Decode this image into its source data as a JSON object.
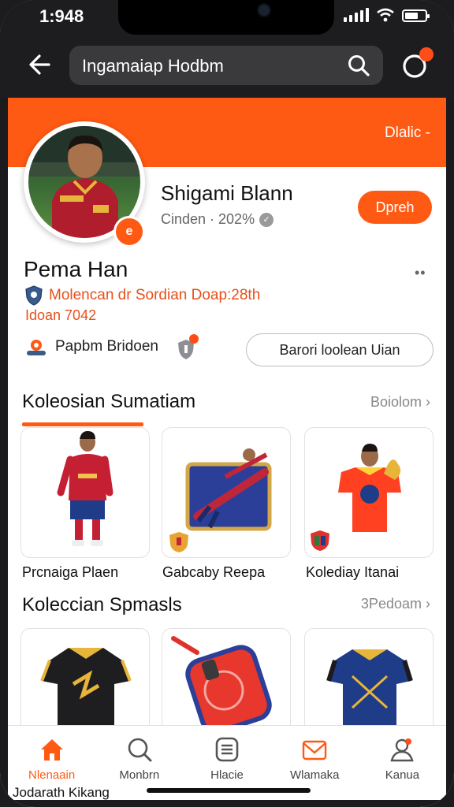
{
  "status": {
    "time": "1:948"
  },
  "search": {
    "value": "Ingamaiap Hodbm"
  },
  "banner": {
    "dropdown": "Dlalic -"
  },
  "profile": {
    "name": "Shigami Blann",
    "sub": "Cinden · 202%",
    "follow_label": "Dpreh",
    "display_name": "Pema Han",
    "club_line": "Molencan dr Sordian Doap:28th",
    "club_line2": "Idoan 7042",
    "friends_label": "Papbm Bridoen",
    "action_button": "Barori loolean Uian",
    "badge_glyph": "е"
  },
  "section1": {
    "title": "Koleosian Sumatiam",
    "more": "Boiolom",
    "items": [
      {
        "label": "Prcnaiga Plaen",
        "icon": "football-player-figure-icon"
      },
      {
        "label": "Gabcaby Reepa",
        "icon": "player-card-icon"
      },
      {
        "label": "Kolediay Itanai",
        "icon": "jersey-trophy-icon"
      }
    ]
  },
  "section2": {
    "title": "Koleccian Spmasls",
    "more": "3Pedoam",
    "items": [
      {
        "icon": "black-jersey-icon"
      },
      {
        "icon": "phone-case-icon"
      },
      {
        "icon": "blue-jersey-icon"
      }
    ]
  },
  "nav": [
    {
      "label": "Nlenaain",
      "icon": "home-icon",
      "active": true
    },
    {
      "label": "Monbrn",
      "icon": "search-icon",
      "active": false
    },
    {
      "label": "Hlacie",
      "icon": "list-icon",
      "active": false
    },
    {
      "label": "Wlamaka",
      "icon": "mail-icon",
      "active": false
    },
    {
      "label": "Kanua",
      "icon": "profile-icon",
      "active": false
    }
  ],
  "footer": {
    "text": "Jodarath Kikang"
  },
  "colors": {
    "accent": "#ff5a14",
    "dark_bar": "#1d1d1f"
  }
}
